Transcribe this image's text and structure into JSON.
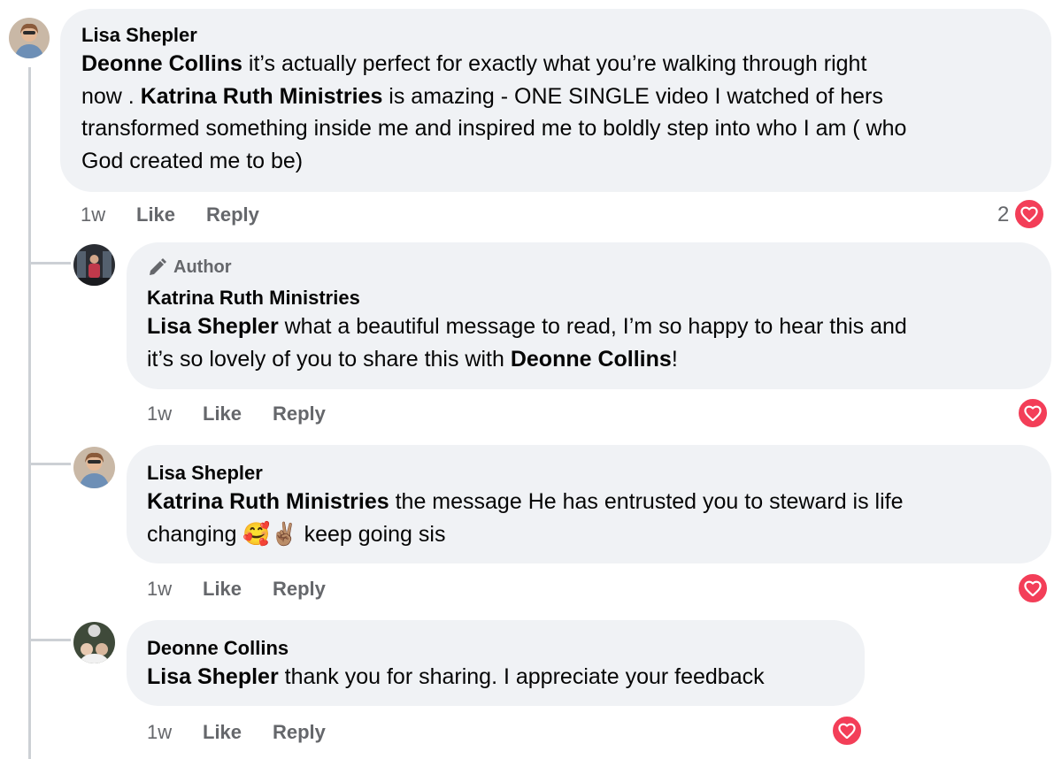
{
  "comments": [
    {
      "author": "Lisa Shepler",
      "lines": [
        [
          {
            "t": "Deonne Collins",
            "b": true
          },
          {
            "t": " it’s actually perfect for exactly what you’re walking through right"
          }
        ],
        [
          {
            "t": "now . "
          },
          {
            "t": "Katrina Ruth Ministries",
            "b": true
          },
          {
            "t": " is amazing - ONE SINGLE video I watched of hers"
          }
        ],
        [
          {
            "t": "transformed something inside me and inspired me to boldly step into who I am ( who"
          }
        ],
        [
          {
            "t": "God created me to be)"
          }
        ]
      ],
      "time": "1w",
      "like": "Like",
      "reply": "Reply",
      "reaction_count": "2"
    }
  ],
  "replies": [
    {
      "badge": "Author",
      "author": "Katrina Ruth Ministries",
      "lines": [
        [
          {
            "t": "Lisa Shepler",
            "b": true
          },
          {
            "t": " what a beautiful message to read, I’m so happy to hear this and"
          }
        ],
        [
          {
            "t": "it’s so lovely of you to share this with "
          },
          {
            "t": "Deonne Collins",
            "b": true
          },
          {
            "t": "!"
          }
        ]
      ],
      "time": "1w",
      "like": "Like",
      "reply": "Reply"
    },
    {
      "author": "Lisa Shepler",
      "lines": [
        [
          {
            "t": "Katrina Ruth Ministries",
            "b": true
          },
          {
            "t": " the message He has entrusted you to steward is life"
          }
        ],
        [
          {
            "t": "changing 🥰✌🏽 keep going sis"
          }
        ]
      ],
      "time": "1w",
      "like": "Like",
      "reply": "Reply"
    },
    {
      "author": "Deonne Collins",
      "lines": [
        [
          {
            "t": "Lisa Shepler",
            "b": true
          },
          {
            "t": " thank you for sharing. I appreciate your feedback"
          }
        ]
      ],
      "time": "1w",
      "like": "Like",
      "reply": "Reply"
    }
  ],
  "icons": {
    "reaction": "heart-icon",
    "author_badge": "pen-icon"
  },
  "colors": {
    "bubble": "#f0f2f5",
    "heart": "#f33e58",
    "meta": "#65676b"
  }
}
